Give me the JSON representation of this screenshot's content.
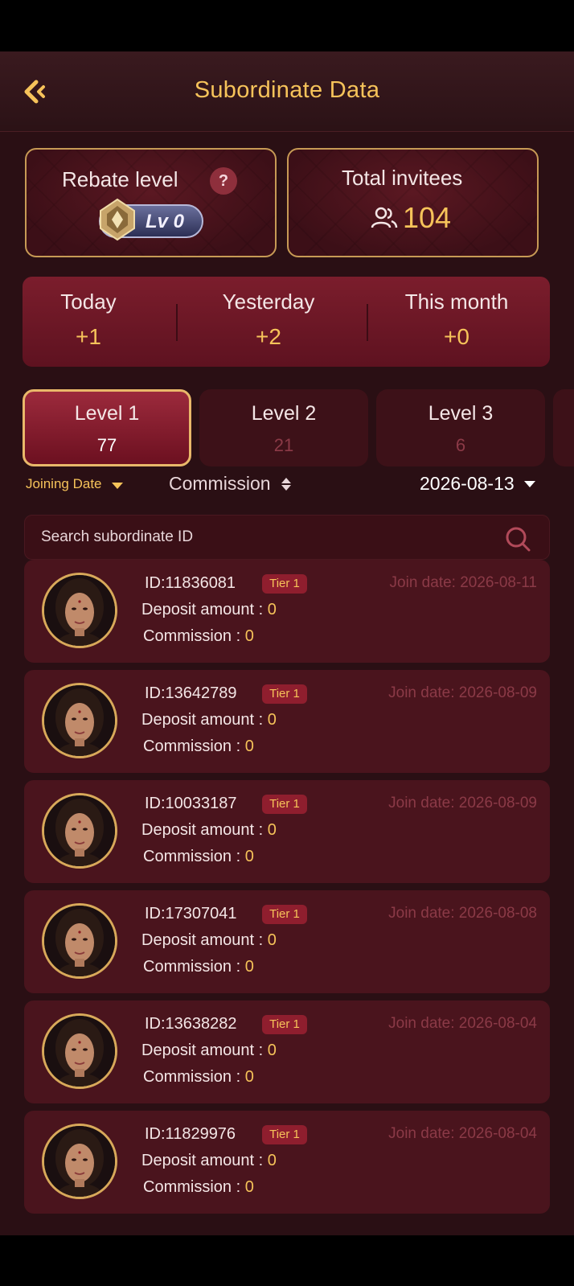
{
  "header": {
    "title": "Subordinate Data"
  },
  "rebate": {
    "label": "Rebate level",
    "help": "?",
    "level_text": "Lv 0"
  },
  "invitees": {
    "label": "Total invitees",
    "count": "104"
  },
  "stats": [
    {
      "label": "Today",
      "value": "+1"
    },
    {
      "label": "Yesterday",
      "value": "+2"
    },
    {
      "label": "This month",
      "value": "+0"
    }
  ],
  "levels": [
    {
      "name": "Level 1",
      "count": "77",
      "active": true
    },
    {
      "name": "Level 2",
      "count": "21",
      "active": false
    },
    {
      "name": "Level 3",
      "count": "6",
      "active": false
    }
  ],
  "filters": {
    "joining_date": "Joining Date",
    "commission": "Commission",
    "date": "2026-08-13"
  },
  "search": {
    "placeholder": "Search subordinate ID"
  },
  "labels": {
    "deposit": "Deposit amount : ",
    "commission": "Commission : "
  },
  "subordinates": [
    {
      "id": "ID:11836081",
      "tier": "Tier 1",
      "join": "Join date: 2026-08-11",
      "deposit": "0",
      "commission": "0"
    },
    {
      "id": "ID:13642789",
      "tier": "Tier 1",
      "join": "Join date: 2026-08-09",
      "deposit": "0",
      "commission": "0"
    },
    {
      "id": "ID:10033187",
      "tier": "Tier 1",
      "join": "Join date: 2026-08-09",
      "deposit": "0",
      "commission": "0"
    },
    {
      "id": "ID:17307041",
      "tier": "Tier 1",
      "join": "Join date: 2026-08-08",
      "deposit": "0",
      "commission": "0"
    },
    {
      "id": "ID:13638282",
      "tier": "Tier 1",
      "join": "Join date: 2026-08-04",
      "deposit": "0",
      "commission": "0"
    },
    {
      "id": "ID:11829976",
      "tier": "Tier 1",
      "join": "Join date: 2026-08-04",
      "deposit": "0",
      "commission": "0"
    }
  ],
  "colors": {
    "accent": "#f6c35a",
    "background": "#2a0f14",
    "card": "#4a141d"
  }
}
